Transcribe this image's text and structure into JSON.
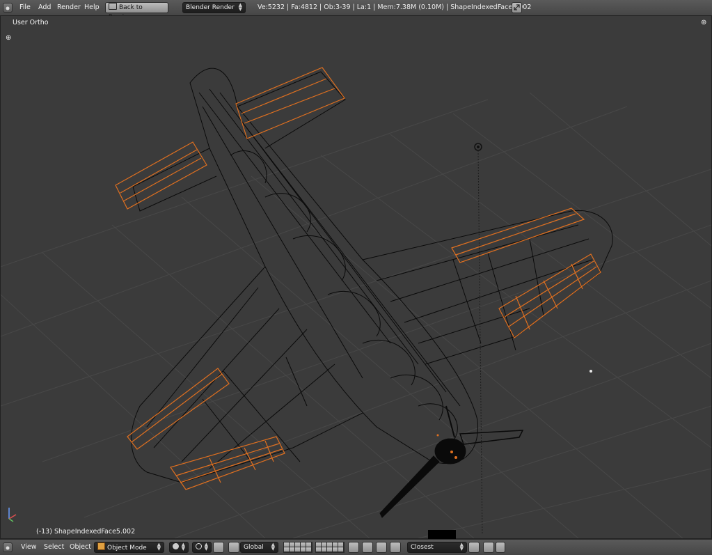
{
  "topbar": {
    "menus": [
      "File",
      "Add",
      "Render",
      "Help"
    ],
    "back_button": "Back to Previous",
    "render_engine": "Blender Render",
    "stats": "Ve:5232 | Fa:4812 | Ob:3-39 | La:1 | Mem:7.38M (0.10M) | ShapeIndexedFace5.002"
  },
  "viewport": {
    "view_name": "User Ortho",
    "object_info": "(-13) ShapeIndexedFace5.002"
  },
  "bottombar": {
    "menus": [
      "View",
      "Select",
      "Object"
    ],
    "mode": "Object Mode",
    "orientation": "Global",
    "snap_target": "Closest"
  },
  "colors": {
    "wire": "#000000",
    "selected_wire": "#e07020",
    "grid": "#4a4a4a",
    "background": "#3b3b3b"
  }
}
